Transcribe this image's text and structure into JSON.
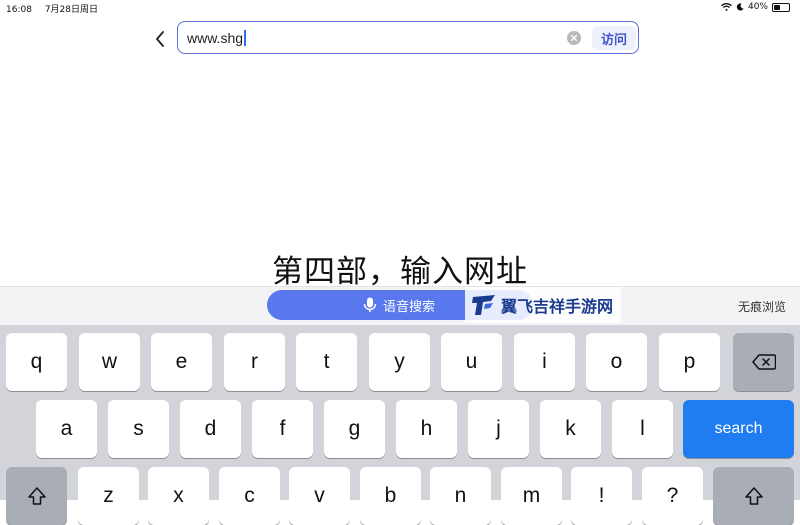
{
  "status_bar": {
    "time": "16:08",
    "date": "7月28日周日",
    "battery": "40%",
    "battery_level": 0.4
  },
  "address_bar": {
    "url_value": "www.shg",
    "visit_label": "访问"
  },
  "caption": "第四部，输入网址",
  "suggestion_bar": {
    "voice_label": "语音搜索",
    "watermark_text": "翼飞吉祥手游网",
    "incognito_label": "无痕浏览"
  },
  "keyboard": {
    "row1": [
      "q",
      "w",
      "e",
      "r",
      "t",
      "y",
      "u",
      "i",
      "o",
      "p"
    ],
    "row2": [
      "a",
      "s",
      "d",
      "f",
      "g",
      "h",
      "j",
      "k",
      "l"
    ],
    "search_label": "search",
    "row3": [
      "z",
      "x",
      "c",
      "v",
      "b",
      "n",
      "m",
      "!",
      "?"
    ]
  },
  "colors": {
    "accent": "#5a78ee",
    "search_key": "#1f7cf1",
    "url_border": "#5b6fd6"
  }
}
